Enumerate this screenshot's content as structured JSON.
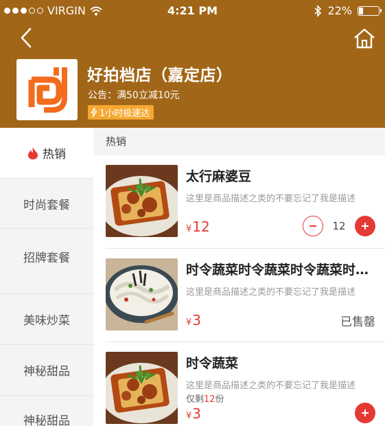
{
  "status_bar": {
    "carrier": "VIRGIN",
    "time": "4:21 PM",
    "battery_percent": "22%",
    "battery_level": 0.22,
    "signal_bars_filled": 3,
    "signal_bars_total": 5
  },
  "colors": {
    "header_bg": "#a16617",
    "accent_red": "#e53935",
    "tag_orange": "#f7a830",
    "logo_orange": "#f26c1e"
  },
  "nav": {
    "back_icon": "chevron-left-icon",
    "home_icon": "home-icon"
  },
  "shop": {
    "name": "好拍档店（嘉定店）",
    "notice": "公告：满50立减10元",
    "delivery_tag": "1小时极速达"
  },
  "sidebar": {
    "items": [
      {
        "label": "热销",
        "active": true,
        "icon": "fire-icon"
      },
      {
        "label": "时尚套餐",
        "active": false
      },
      {
        "label": "招牌套餐",
        "active": false
      },
      {
        "label": "美味炒菜",
        "active": false
      },
      {
        "label": "神秘甜品",
        "active": false
      },
      {
        "label": "神秘甜品",
        "active": false
      }
    ]
  },
  "main": {
    "section_title": "热销",
    "items": [
      {
        "name": "太行麻婆豆",
        "desc": "这里是商品描述之类的不要忘记了我是描述",
        "currency": "¥",
        "price": "12",
        "quantity": "12",
        "image": "tofu-dish",
        "state": "in-cart"
      },
      {
        "name": "时令蔬菜时令蔬菜时令蔬菜时令蔬菜",
        "desc": "这里是商品描述之类的不要忘记了我是描述",
        "currency": "¥",
        "price": "3",
        "soldout_label": "已售罄",
        "image": "noodle-dish",
        "state": "sold-out"
      },
      {
        "name": "时令蔬菜",
        "desc": "这里是商品描述之类的不要忘记了我是描述",
        "stock_prefix": "仅剩",
        "stock_count": "12",
        "stock_suffix": "份",
        "currency": "¥",
        "price": "3",
        "image": "tofu-dish",
        "state": "addable"
      }
    ]
  }
}
